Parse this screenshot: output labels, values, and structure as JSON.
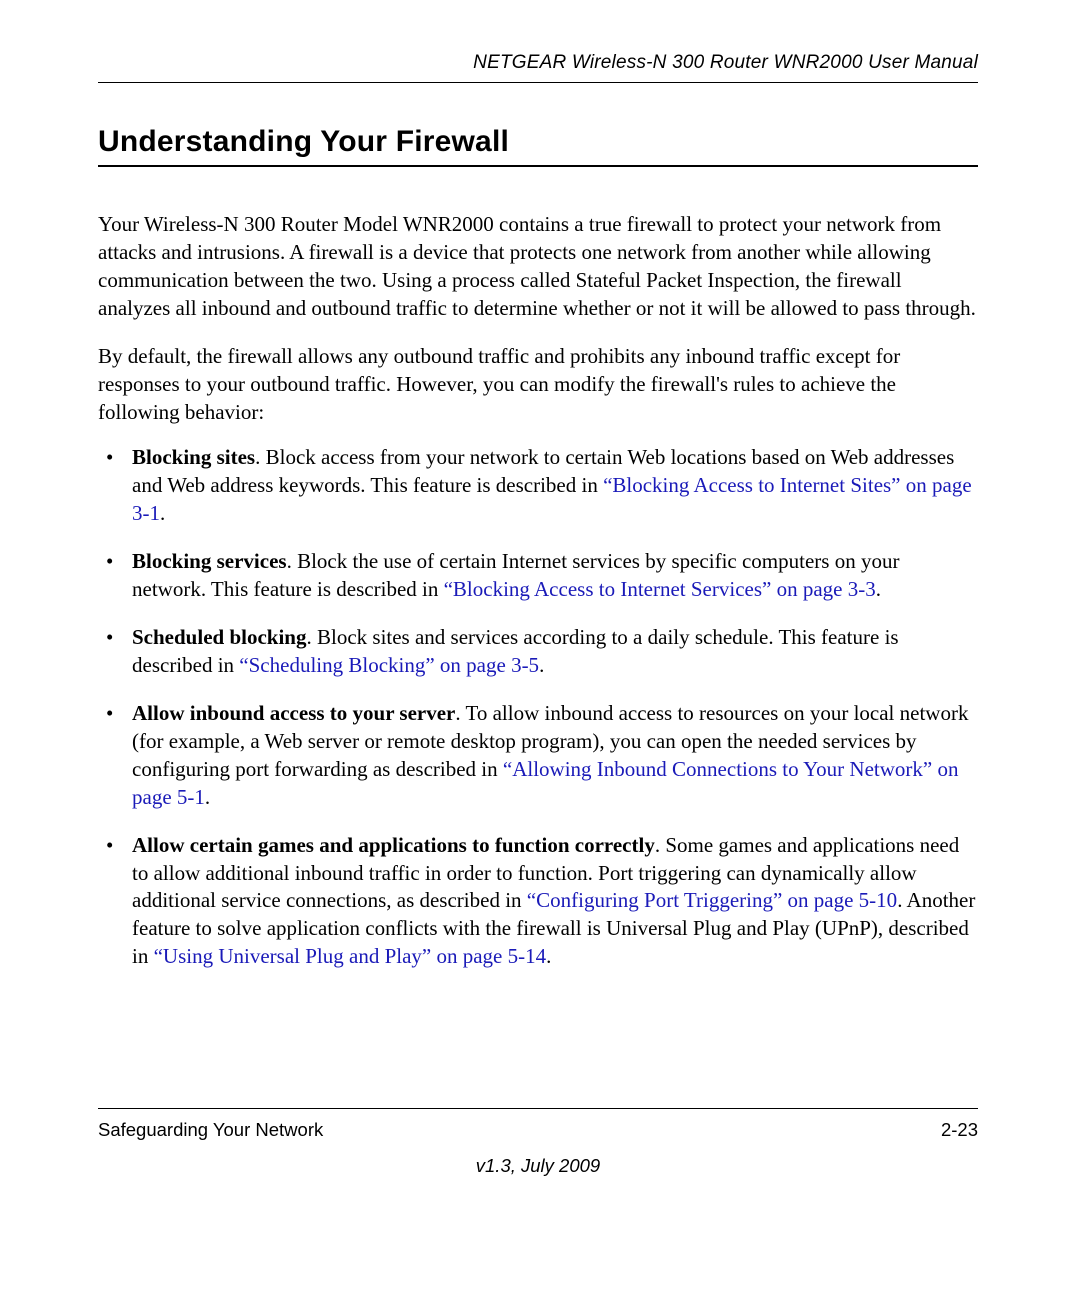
{
  "header": {
    "doc_title": "NETGEAR Wireless-N 300 Router WNR2000 User Manual"
  },
  "section": {
    "title": "Understanding Your Firewall"
  },
  "paragraphs": {
    "p1": "Your Wireless-N 300 Router Model WNR2000 contains a true firewall to protect your network from attacks and intrusions. A firewall is a device that protects one network from another while allowing communication between the two. Using a process called Stateful Packet Inspection, the firewall analyzes all inbound and outbound traffic to determine whether or not it will be allowed to pass through.",
    "p2": "By default, the firewall allows any outbound traffic and prohibits any inbound traffic except for responses to your outbound traffic. However, you can modify the firewall's rules to achieve the following behavior:"
  },
  "list": {
    "item1": {
      "bold": "Blocking sites",
      "text1": ". Block access from your network to certain Web locations based on Web addresses and Web address keywords. This feature is described in ",
      "link": "“Blocking Access to Internet Sites” on page 3-1",
      "text2": "."
    },
    "item2": {
      "bold": "Blocking services",
      "text1": ". Block the use of certain Internet services by specific computers on your network. This feature is described in ",
      "link": "“Blocking Access to Internet Services” on page 3-3",
      "text2": "."
    },
    "item3": {
      "bold": "Scheduled blocking",
      "text1": ". Block sites and services according to a daily schedule. This feature is described in ",
      "link": "“Scheduling Blocking” on page 3-5",
      "text2": "."
    },
    "item4": {
      "bold": "Allow inbound access to your server",
      "text1": ". To allow inbound access to resources on your local network (for example, a Web server or remote desktop program), you can open the needed services by configuring port forwarding as described in ",
      "link": "“Allowing Inbound Connections to Your Network” on page 5-1",
      "text2": "."
    },
    "item5": {
      "bold": "Allow certain games and applications to function correctly",
      "text1": ". Some games and applications need to allow additional inbound traffic in order to function. Port triggering can dynamically allow additional service connections, as described in ",
      "link1": "“Configuring Port Triggering” on page 5-10",
      "text2": ". Another feature to solve application conflicts with the firewall is Universal Plug and Play (UPnP), described in ",
      "link2": "“Using Universal Plug and Play” on page 5-14",
      "text3": "."
    }
  },
  "footer": {
    "chapter": "Safeguarding Your Network",
    "page_number": "2-23",
    "version": "v1.3, July 2009"
  }
}
